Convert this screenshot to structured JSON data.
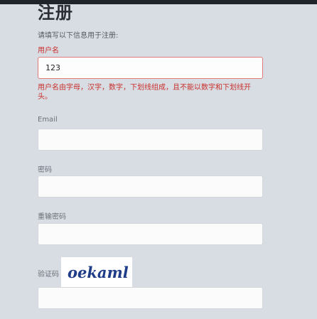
{
  "page": {
    "title": "注册",
    "subtitle": "请填写以下信息用于注册:"
  },
  "username": {
    "label": "用户名",
    "value": "123",
    "error": "用户名由字母，汉字，数字，下划线组成，且不能以数字和下划线开头。"
  },
  "email": {
    "label": "Email",
    "value": ""
  },
  "password": {
    "label": "密码",
    "value": ""
  },
  "confirm_password": {
    "label": "重输密码",
    "value": ""
  },
  "captcha": {
    "label": "验证码",
    "image_text": "oekaml",
    "value": ""
  },
  "colors": {
    "error": "#c9302c",
    "captcha_text": "#1f3c88"
  }
}
